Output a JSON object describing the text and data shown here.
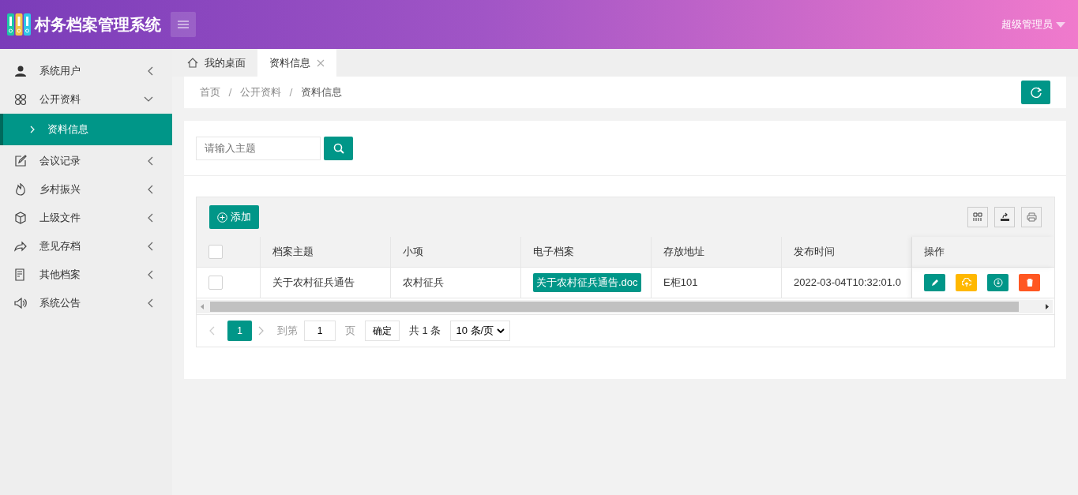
{
  "header": {
    "title": "村务档案管理系统",
    "user": "超级管理员"
  },
  "sidebar": {
    "items": [
      {
        "label": "系统用户",
        "expanded": false
      },
      {
        "label": "公开资料",
        "expanded": true,
        "children": [
          {
            "label": "资料信息",
            "selected": true
          }
        ]
      },
      {
        "label": "会议记录",
        "expanded": false
      },
      {
        "label": "乡村振兴",
        "expanded": false
      },
      {
        "label": "上级文件",
        "expanded": false
      },
      {
        "label": "意见存档",
        "expanded": false
      },
      {
        "label": "其他档案",
        "expanded": false
      },
      {
        "label": "系统公告",
        "expanded": false
      }
    ]
  },
  "tabs": [
    {
      "kind": "home",
      "label": "我的桌面",
      "selected": false
    },
    {
      "kind": "page",
      "label": "资料信息",
      "selected": true
    }
  ],
  "breadcrumb": [
    "首页",
    "公开资料",
    "资料信息"
  ],
  "search": {
    "placeholder": "请输入主题"
  },
  "toolbar": {
    "add_label": "添加"
  },
  "table": {
    "header_checked": false,
    "columns": [
      "档案主题",
      "小项",
      "电子档案",
      "存放地址",
      "发布时间",
      "操作"
    ],
    "rows": [
      {
        "checked": false,
        "subject": "关于农村征兵通告",
        "item": "农村征兵",
        "file": "关于农村征兵通告.doc",
        "location": "E柜101",
        "published": "2022-03-04T10:32:01.0",
        "actions": [
          {
            "kind": "edit"
          },
          {
            "kind": "upload"
          },
          {
            "kind": "download"
          },
          {
            "kind": "delete"
          }
        ]
      }
    ]
  },
  "pagination": {
    "current": "1",
    "goto_label": "到第",
    "goto_value": "1",
    "page_label": "页",
    "confirm": "确定",
    "total": "共 1 条",
    "page_size": "10 条/页"
  }
}
